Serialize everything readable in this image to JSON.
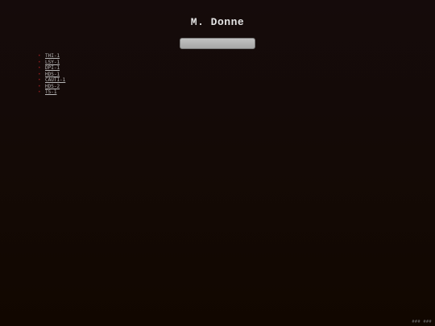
{
  "page": {
    "title": "M. Donne",
    "background_top": "#150b0b",
    "background_bottom": "#110700",
    "accent": "#8a1c1c"
  },
  "search": {
    "value": ""
  },
  "links": [
    {
      "label": "THI-1"
    },
    {
      "label": "LSY-1"
    },
    {
      "label": "DPI-1"
    },
    {
      "label": "HDS-1"
    },
    {
      "label": "CAUTI-1"
    },
    {
      "label": "HDS-2"
    },
    {
      "label": "TS-1"
    }
  ],
  "footer": {
    "mark": "### ###"
  }
}
